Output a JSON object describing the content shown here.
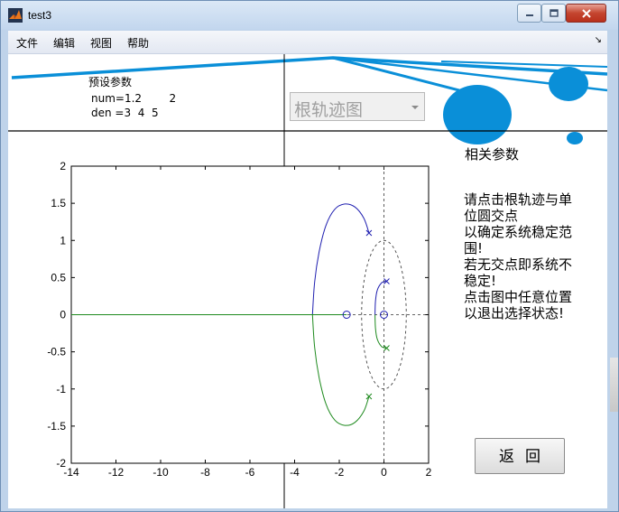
{
  "window": {
    "title": "test3",
    "controls": {
      "minimize": "minimize-icon",
      "maximize": "maximize-icon",
      "close": "close-icon"
    }
  },
  "menu": {
    "items": [
      "文件",
      "编辑",
      "视图",
      "帮助"
    ]
  },
  "params": {
    "title": "预设参数",
    "num_line": "num=1.2        2",
    "den_line": "den =3  4  5"
  },
  "plot_select": {
    "value": "根轨迹图"
  },
  "related": {
    "title": "相关参数",
    "instructions": [
      "请点击根轨迹与单",
      "位圆交点",
      "以确定系统稳定范",
      "围!",
      "若无交点即系统不",
      "稳定!",
      "点击图中任意位置",
      "以退出选择状态!"
    ]
  },
  "return_button": {
    "label": "返回"
  },
  "colors": {
    "branch_blue": "#1f1fb0",
    "branch_green": "#1e8a1e",
    "splash": "#0a8fd8"
  },
  "chart_data": {
    "type": "line",
    "title": "",
    "xlabel": "",
    "ylabel": "",
    "xlim": [
      -14,
      2
    ],
    "ylim": [
      -2,
      2
    ],
    "xticks": [
      -14,
      -12,
      -10,
      -8,
      -6,
      -4,
      -2,
      0,
      2
    ],
    "yticks": [
      -2,
      -1.5,
      -1,
      -0.5,
      0,
      0.5,
      1,
      1.5,
      2
    ],
    "xtick_labels": [
      "-14",
      "-12",
      "-10",
      "-8",
      "-6",
      "-4",
      "-2",
      "0",
      "2"
    ],
    "ytick_labels": [
      "-2",
      "-1.5",
      "-1",
      "-0.5",
      "0",
      "0.5",
      "1",
      "1.5",
      "2"
    ],
    "poles": [
      [
        -0.67,
        1.1
      ],
      [
        -0.67,
        -1.1
      ],
      [
        0.12,
        0.45
      ],
      [
        0.12,
        -0.45
      ]
    ],
    "zeros": [
      [
        -1.67,
        0
      ],
      [
        0.0,
        0
      ]
    ],
    "unit_circle": {
      "center": [
        0,
        0
      ],
      "radius": 1
    },
    "series": [
      {
        "color": "#1f1fb0",
        "x": [
          -0.67,
          -0.9,
          -1.3,
          -1.75,
          -2.2,
          -2.6,
          -2.9,
          -3.1,
          -3.2
        ],
        "y": [
          1.1,
          1.3,
          1.45,
          1.49,
          1.42,
          1.2,
          0.85,
          0.45,
          0
        ]
      },
      {
        "color": "#1e8a1e",
        "x": [
          -3.2,
          -3.1,
          -2.9,
          -2.6,
          -2.2,
          -1.75,
          -1.3,
          -0.9,
          -0.67
        ],
        "y": [
          0,
          -0.45,
          -0.85,
          -1.2,
          -1.42,
          -1.49,
          -1.45,
          -1.3,
          -1.1
        ]
      },
      {
        "color": "#1f1fb0",
        "x": [
          0.12,
          -0.1,
          -0.3,
          -0.38,
          -0.4
        ],
        "y": [
          0.45,
          0.43,
          0.33,
          0.18,
          0
        ]
      },
      {
        "color": "#1e8a1e",
        "x": [
          -0.4,
          -0.38,
          -0.3,
          -0.1,
          0.12
        ],
        "y": [
          0,
          -0.18,
          -0.33,
          -0.43,
          -0.45
        ]
      },
      {
        "color": "#1e8a1e",
        "x": [
          -14,
          -1.67
        ],
        "y": [
          0,
          0
        ]
      }
    ]
  }
}
